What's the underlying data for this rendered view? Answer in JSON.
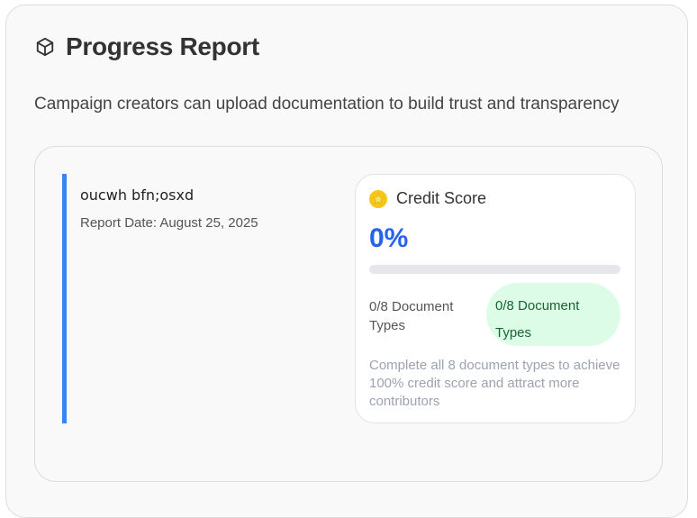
{
  "header": {
    "icon": "cube-icon",
    "title": "Progress Report"
  },
  "subtitle": "Campaign creators can upload documentation to build trust and transparency",
  "report": {
    "name": "oucwh bfn;osxd",
    "date": "Report Date: August 25, 2025",
    "accent_color": "#3b82f6"
  },
  "credit_score": {
    "icon": "star-icon",
    "title": "Credit Score",
    "percent_label": "0%",
    "progress": 0,
    "document_count_label": "0/8 Document Types",
    "badge_label": "0/8 Document Types",
    "note": "Complete all 8 document types to achieve 100% credit score and attract more contributors",
    "accent_color": "#2563eb",
    "badge_color": "#dcfce7"
  }
}
